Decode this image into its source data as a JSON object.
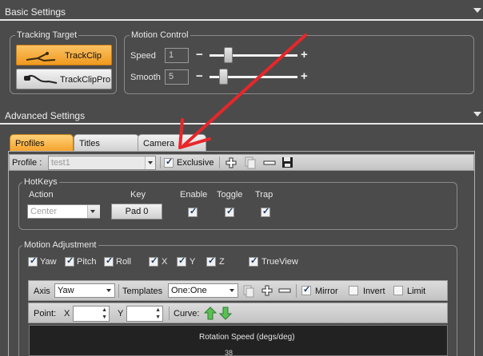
{
  "basic_settings": {
    "title": "Basic Settings"
  },
  "tracking_target": {
    "title": "Tracking Target",
    "options": [
      {
        "label": "TrackClip",
        "selected": true
      },
      {
        "label": "TrackClipPro",
        "selected": false
      }
    ]
  },
  "motion_control": {
    "title": "Motion Control",
    "speed": {
      "label": "Speed",
      "value": "1",
      "level": 0.36
    },
    "smooth": {
      "label": "Smooth",
      "value": "5",
      "level": 0.26
    },
    "minus": "−",
    "plus": "+"
  },
  "advanced_settings": {
    "title": "Advanced Settings"
  },
  "tabs": [
    {
      "label": "Profiles",
      "active": true
    },
    {
      "label": "Titles",
      "active": false
    },
    {
      "label": "Camera",
      "active": false
    }
  ],
  "profile_bar": {
    "label": "Profile :",
    "value": "test1",
    "exclusive_label": "Exclusive",
    "exclusive_checked": true
  },
  "hotkeys": {
    "title": "HotKeys",
    "action_header": "Action",
    "key_header": "Key",
    "enable_header": "Enable",
    "toggle_header": "Toggle",
    "trap_header": "Trap",
    "action_value": "Center",
    "key_value": "Pad 0",
    "enable": true,
    "toggle": true,
    "trap": true
  },
  "motion_adjustment": {
    "title": "Motion Adjustment",
    "axes": [
      {
        "label": "Yaw",
        "checked": true
      },
      {
        "label": "Pitch",
        "checked": true
      },
      {
        "label": "Roll",
        "checked": true
      },
      {
        "label": "X",
        "checked": true
      },
      {
        "label": "Y",
        "checked": true
      },
      {
        "label": "Z",
        "checked": true
      },
      {
        "label": "TrueView",
        "checked": true
      }
    ],
    "toolbar": {
      "axis_label": "Axis",
      "axis_value": "Yaw",
      "templates_label": "Templates",
      "templates_value": "One:One",
      "mirror_label": "Mirror",
      "mirror": true,
      "invert_label": "Invert",
      "invert": false,
      "limit_label": "Limit",
      "limit": false
    },
    "point_bar": {
      "point_label": "Point:",
      "x_label": "X",
      "y_label": "Y",
      "curve_label": "Curve:"
    },
    "graph": {
      "title": "Rotation Speed (degs/deg)",
      "y_tick": "38"
    }
  },
  "colors": {
    "background": "#4b4b4b",
    "accent_orange": "#f5a12a",
    "annotation_arrow": "#e8262a",
    "curve_arrow_green": "#4caf50"
  }
}
